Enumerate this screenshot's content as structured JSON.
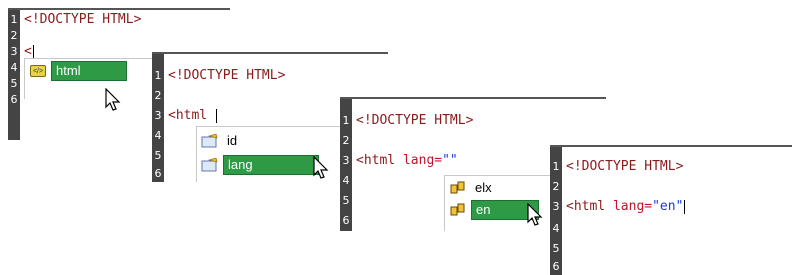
{
  "panels": [
    {
      "line_numbers": [
        "1",
        "2",
        "3",
        "4",
        "5",
        "6"
      ],
      "line1": "<!DOCTYPE HTML>",
      "line3_typed": "<",
      "popup_items": [
        {
          "label": "html",
          "icon": "element-icon",
          "selected": true
        }
      ]
    },
    {
      "line_numbers": [
        "1",
        "2",
        "3",
        "4",
        "5",
        "6"
      ],
      "line1": "<!DOCTYPE HTML>",
      "line3_tag": "<html",
      "popup_items": [
        {
          "label": "id",
          "icon": "attribute-icon",
          "selected": false
        },
        {
          "label": "lang",
          "icon": "attribute-icon",
          "selected": true
        }
      ]
    },
    {
      "line_numbers": [
        "1",
        "2",
        "3",
        "4",
        "5",
        "6"
      ],
      "line1": "<!DOCTYPE HTML>",
      "line3_tag": "<html",
      "line3_attr": "lang=",
      "line3_value": "\"\"",
      "popup_items": [
        {
          "label": "elx",
          "icon": "value-icon",
          "selected": false
        },
        {
          "label": "en",
          "icon": "value-icon",
          "selected": true
        }
      ]
    },
    {
      "line_numbers": [
        "1",
        "2",
        "3",
        "4",
        "5",
        "6"
      ],
      "line1": "<!DOCTYPE HTML>",
      "line3_tag": "<html",
      "line3_attr": "lang=",
      "line3_value": "\"en\""
    }
  ],
  "colors": {
    "gutter": "#444444",
    "selection": "#2e9a45",
    "tag": "#8a1b1b",
    "attribute": "#c8102e",
    "value": "#1c3bd6"
  }
}
